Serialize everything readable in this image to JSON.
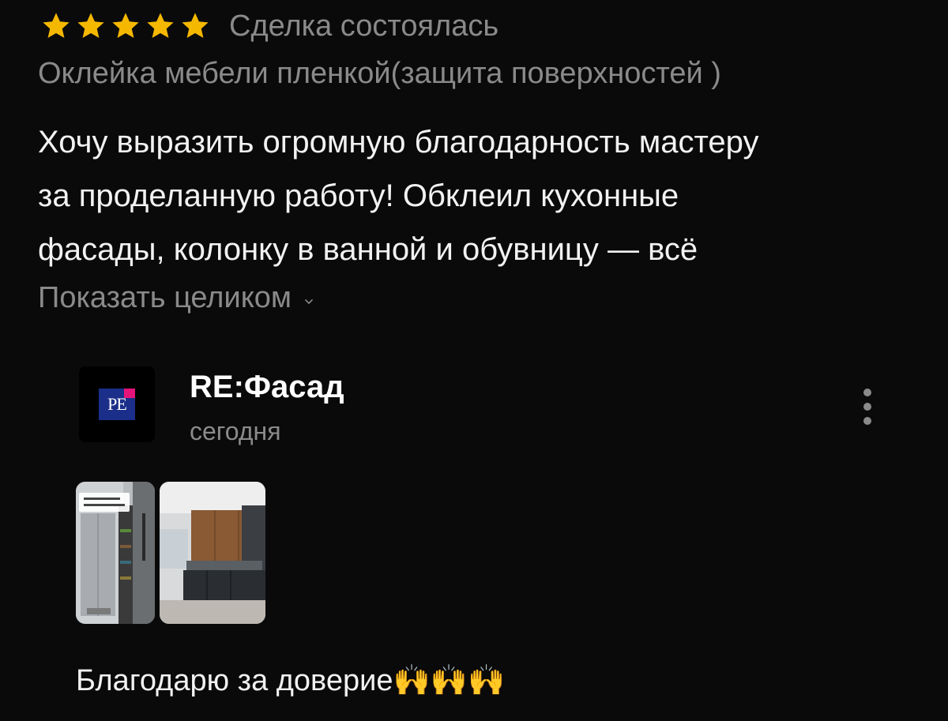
{
  "review": {
    "rating": 5,
    "rating_max": 5,
    "star_color": "#f5b800",
    "deal_status": "Сделка состоялась",
    "service": "Оклейка мебели пленкой(защита поверхностей )",
    "text_lines": [
      "Хочу выразить огромную благодарность мастеру",
      "за проделанную работу! Обклеил кухонные",
      "фасады, колонку в ванной и обувницу — всё"
    ],
    "show_more_label": "Показать целиком"
  },
  "reply": {
    "avatar_logo_text": "РЕ",
    "company_name": "RE:Фасад",
    "date": "сегодня",
    "photos": [
      "photo-hallway-wardrobe",
      "photo-kitchen-facades"
    ],
    "text": "Благодарю за доверие🙌🙌🙌"
  },
  "colors": {
    "background": "#0a0a0a",
    "muted_text": "#8a8a8a",
    "logo_blue": "#1b2f8a",
    "logo_pink": "#e5147a"
  }
}
